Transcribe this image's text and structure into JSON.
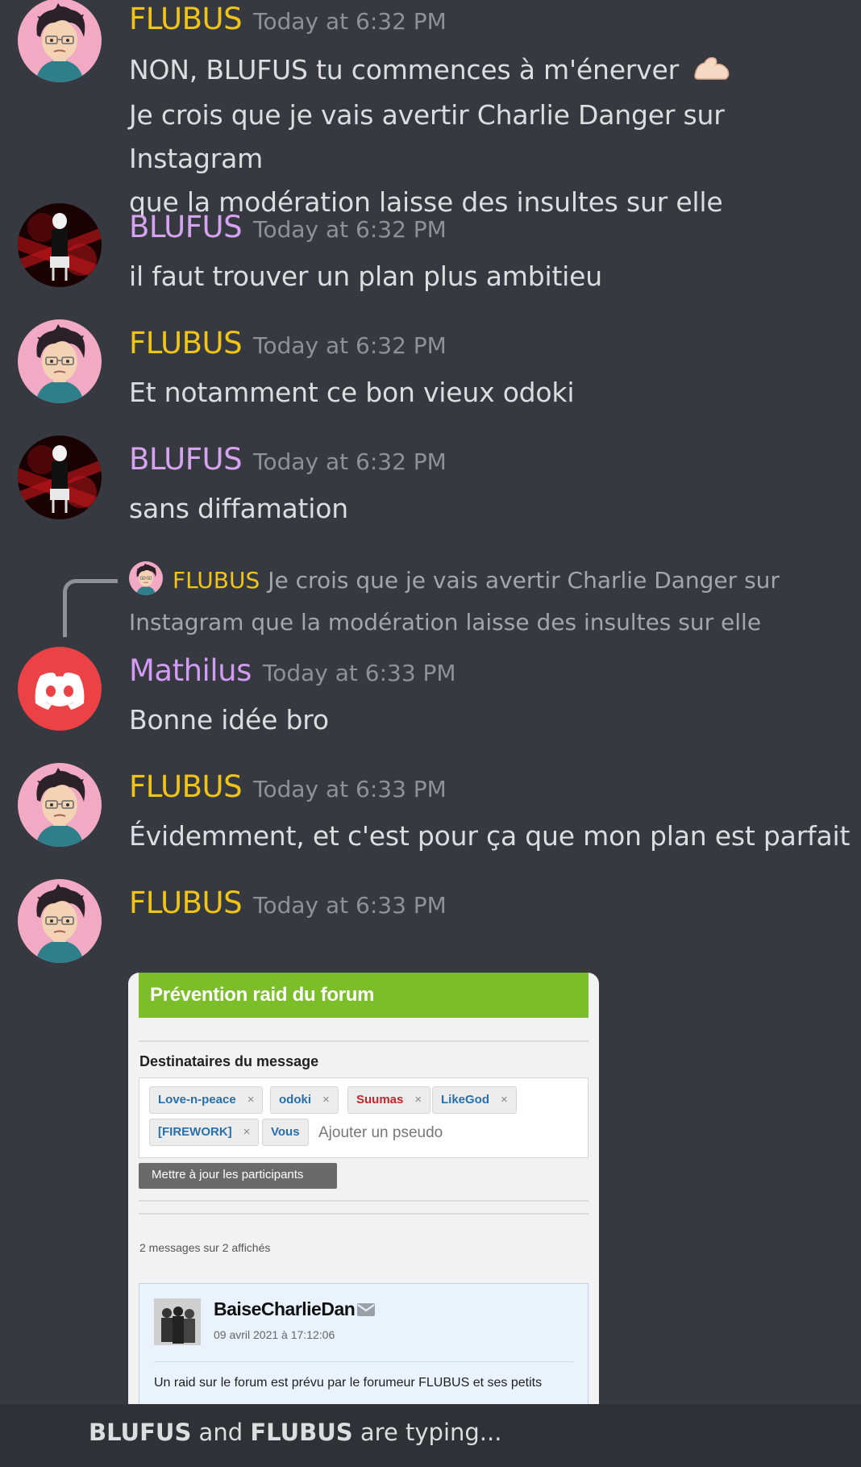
{
  "colors": {
    "flubus": "#f0c419",
    "blufus": "#d5a3f0",
    "mathilus": "#d39bf6",
    "timestamp": "#8e9297",
    "background": "#36393f"
  },
  "messages": [
    {
      "author": "FLUBUS",
      "time": "Today at 6:32 PM",
      "avatar": "bald-cartoon-avatar",
      "lines": [
        "NON, BLUFUS tu commences à m'énerver",
        "Je crois que je vais avertir Charlie Danger sur Instagram",
        "que la modération laisse des insultes sur elle"
      ],
      "emoji": "flexed-biceps-emoji"
    },
    {
      "author": "BLUFUS",
      "time": "Today at 6:32 PM",
      "avatar": "red-dark-figure-avatar",
      "lines": [
        "il faut trouver un plan plus ambitieu"
      ]
    },
    {
      "author": "FLUBUS",
      "time": "Today at 6:32 PM",
      "avatar": "bald-cartoon-avatar",
      "lines": [
        "Et notamment ce bon vieux odoki"
      ]
    },
    {
      "author": "BLUFUS",
      "time": "Today at 6:32 PM",
      "avatar": "red-dark-figure-avatar",
      "lines": [
        "sans diffamation"
      ]
    },
    {
      "reply_to": {
        "author": "FLUBUS",
        "text": "Je crois que je vais avertir Charlie Danger sur Instagram que la modération laisse des insultes sur elle"
      },
      "author": "Mathilus",
      "time": "Today at 6:33 PM",
      "avatar": "discord-logo-avatar",
      "lines": [
        "Bonne idée bro"
      ]
    },
    {
      "author": "FLUBUS",
      "time": "Today at 6:33 PM",
      "avatar": "bald-cartoon-avatar",
      "lines": [
        "Évidemment, et c'est pour ça que mon plan est parfait"
      ]
    },
    {
      "author": "FLUBUS",
      "time": "Today at 6:33 PM",
      "avatar": "bald-cartoon-avatar",
      "lines": []
    }
  ],
  "embed": {
    "header": "Prévention raid du forum",
    "recipients_label": "Destinataires du message",
    "tags": [
      {
        "label": "Love-n-peace",
        "color": "blue",
        "removable": true
      },
      {
        "label": "odoki",
        "color": "blue",
        "removable": true
      },
      {
        "label": "Suumas",
        "color": "red",
        "removable": true
      },
      {
        "label": "LikeGod",
        "color": "blue",
        "removable": true
      },
      {
        "label": "[FIREWORK]",
        "color": "blue",
        "removable": true
      },
      {
        "label": "Vous",
        "color": "blue",
        "removable": false
      }
    ],
    "remove_glyph": "×",
    "add_placeholder": "Ajouter un pseudo",
    "update_button": "Mettre à jour les participants",
    "count_text": "2 messages sur 2 affichés",
    "post": {
      "author": "BaiseCharlieDan",
      "date": "09 avril 2021 à 17:12:06",
      "body": "Un raid sur le forum est prévu par le forumeur FLUBUS et ses petits"
    }
  },
  "typing": {
    "user1": "BLUFUS",
    "and": " and ",
    "user2": "FLUBUS",
    "suffix": " are typing..."
  }
}
